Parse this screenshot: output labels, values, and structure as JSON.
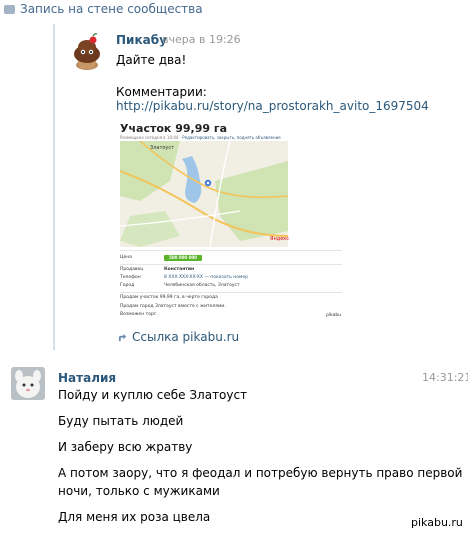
{
  "wall_header": {
    "label": "Запись на стене сообщества",
    "icon": "wall-post-icon"
  },
  "post": {
    "author": "Пикабу",
    "date": "вчера в 19:26",
    "text": "Дайте два!",
    "comments_label": "Комментарии:",
    "link": "http://pikabu.ru/story/na_prostorakh_avito_1697504",
    "attachment": {
      "title": "Участок 99,99 га",
      "subtitle": "Размещено сегодня в 10:44",
      "subtitle_links": "Редактировать, закрыть, поднять объявление",
      "map_city": "Златоуст",
      "map_brand": "Яндекс",
      "price_label": "Цена",
      "price_value": "500 000 000 руб.",
      "seller_label": "Продавец",
      "seller_value": "Константин",
      "phone_label": "Телефон",
      "phone_value": "8 XXX XXX-XX-XX — показать номер",
      "city_label": "Город",
      "city_value": "Челябинская область, Златоуст",
      "desc1": "Продам участок 99,99 га, в черте города",
      "desc2": "Продам город Златоуст вместе с жителями.",
      "desc3": "Возможен торг.",
      "logo": "pikabu"
    },
    "share_link": "Ссылка pikabu.ru"
  },
  "comment": {
    "author": "Наталия",
    "time": "14:31:21",
    "lines": [
      "Пойду и куплю себе Златоуст",
      "Буду пытать людей",
      "И заберу всю жратву",
      "А потом заору, что я феодал и потребую вернуть право первой",
      "ночи, только с мужиками",
      "Для меня их роза цвела"
    ]
  },
  "watermark": "pikabu.ru",
  "colors": {
    "link": "#2b587a",
    "header": "#45688e",
    "muted": "#999999",
    "price": "#5ab42a"
  }
}
